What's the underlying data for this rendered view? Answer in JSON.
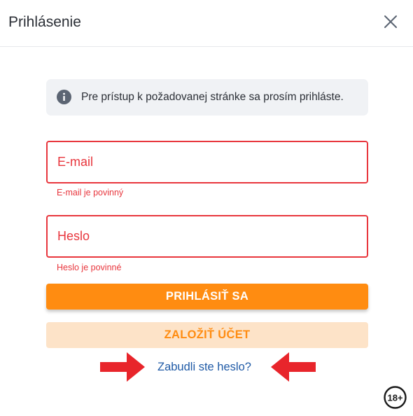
{
  "dialog": {
    "title": "Prihlásenie",
    "close_icon": "close-icon"
  },
  "info": {
    "icon": "info-icon",
    "text": "Pre prístup k požadovanej stránke sa prosím prihláste."
  },
  "form": {
    "email": {
      "placeholder": "E-mail",
      "value": "",
      "error": "E-mail je povinný"
    },
    "password": {
      "placeholder": "Heslo",
      "value": "",
      "error": "Heslo je povinné"
    },
    "login_label": "PRIHLÁSIŤ SA",
    "register_label": "ZALOŽIŤ ÚČET",
    "forgot_label": "Zabudli ste heslo?"
  },
  "annotations": {
    "arrow_icon": "red-arrow-icon",
    "arrow_color": "#e8252b"
  },
  "badge": {
    "icon": "age-18-plus-icon",
    "label": "18+"
  },
  "colors": {
    "accent": "#ff8c11",
    "accent_light": "#fde3c8",
    "error": "#e8363d",
    "link": "#1f5aa6",
    "info_bg": "#f0f2f5"
  }
}
